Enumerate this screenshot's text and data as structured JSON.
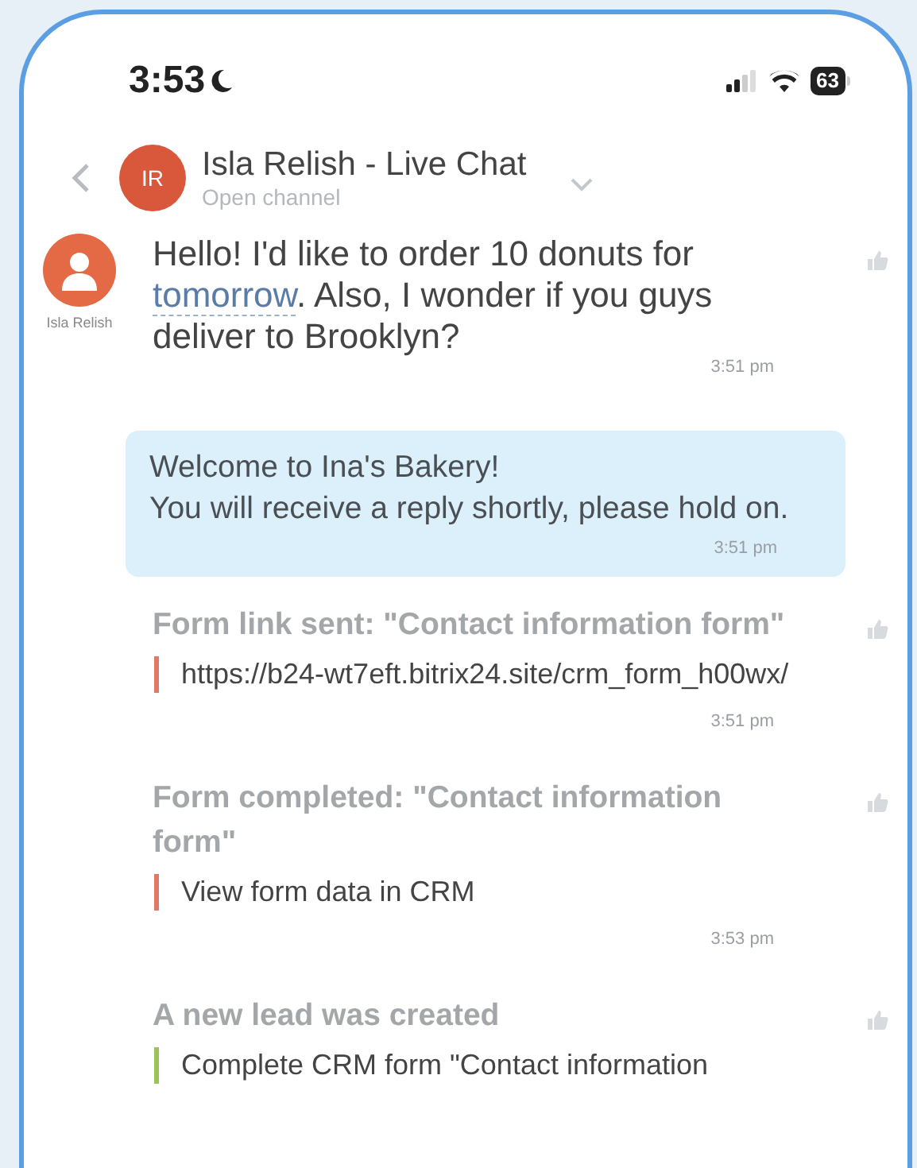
{
  "status_bar": {
    "time": "3:53",
    "battery": "63"
  },
  "header": {
    "avatar_initials": "IR",
    "title": "Isla Relish - Live Chat",
    "subtitle": "Open channel"
  },
  "messages": [
    {
      "kind": "client",
      "author": "Isla Relish",
      "text_before": "Hello! I'd like to order 10 donuts for ",
      "link": "tomorrow",
      "text_after": ". Also, I wonder if you guys deliver to Brooklyn?",
      "time": "3:51 pm"
    },
    {
      "kind": "welcome",
      "lines": [
        "Welcome to Ina's Bakery!",
        "You will receive a reply shortly, please hold on."
      ],
      "time": "3:51 pm"
    },
    {
      "kind": "system",
      "title": "Form link sent: \"Contact information form\"",
      "quote": {
        "text": "https://b24-wt7eft.bitrix24.site/crm_form_h00wx/",
        "color": "#e07a66"
      },
      "time": "3:51 pm"
    },
    {
      "kind": "system",
      "title": "Form completed: \"Contact information form\"",
      "quote": {
        "text": "View form data in CRM",
        "color": "#e07a66"
      },
      "time": "3:53 pm"
    },
    {
      "kind": "system",
      "title": "A new lead was created",
      "quote": {
        "text": "Complete CRM form \"Contact information",
        "color": "#9bc35a"
      }
    }
  ]
}
